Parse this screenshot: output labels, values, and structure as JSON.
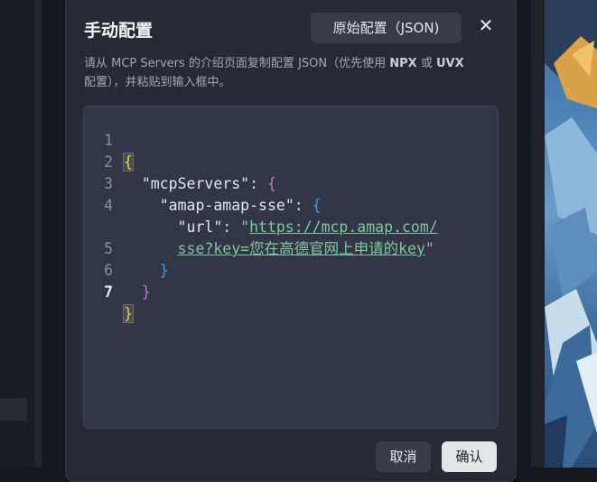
{
  "dialog": {
    "title": "手动配置",
    "raw_config_label": "原始配置（JSON)",
    "close_glyph": "✕",
    "description_prefix": "请从 MCP Servers 的介绍页面复制配置 JSON（优先使用 ",
    "description_npx": "NPX",
    "description_or": " 或 ",
    "description_uvx": "UVX",
    "description_suffix": "配置），并粘贴到输入框中。",
    "cancel_label": "取消",
    "confirm_label": "确认"
  },
  "editor": {
    "active_line": 7,
    "lines": [
      {
        "num": "1",
        "open": "{"
      },
      {
        "num": "2",
        "key": "\"mcpServers\"",
        "colon": ": ",
        "brace": "{"
      },
      {
        "num": "3",
        "key": "\"amap-amap-sse\"",
        "colon": ": ",
        "brace": "{"
      },
      {
        "num": "4",
        "key": "\"url\"",
        "colon": ": ",
        "quote": "\"",
        "url_part1": "https://mcp.amap.com/"
      },
      {
        "num": "",
        "url_part2": "sse?key=您在高德官网上申请的key",
        "close_quote": "\""
      },
      {
        "num": "5",
        "brace": "}"
      },
      {
        "num": "6",
        "brace": "}"
      },
      {
        "num": "7",
        "close": "}"
      }
    ]
  },
  "colors": {
    "modal_bg": "#272a33",
    "editor_bg": "#323647",
    "bracket_level1": "#e8d44d",
    "bracket_level2": "#c26fd8",
    "bracket_level3": "#3d9ee8",
    "string": "#98c379"
  }
}
